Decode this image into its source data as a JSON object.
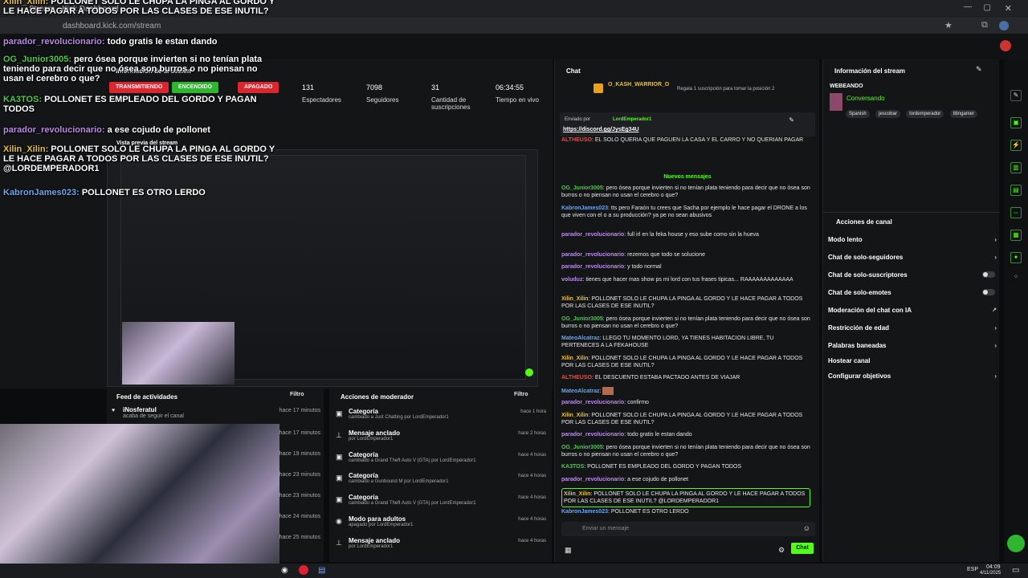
{
  "browser": {
    "tab_title": "Stream - Kick Dashboard",
    "url": "dashboard.kick.com/stream"
  },
  "session": {
    "title": "Información de la sesión",
    "badges": [
      "TRANSMITIENDO",
      "ENCENDIDO",
      "APAGADO"
    ],
    "stats": [
      {
        "value": "131",
        "label": "Espectadores"
      },
      {
        "value": "7098",
        "label": "Seguidores"
      },
      {
        "value": "31",
        "label": "Cantidad de suscripciones"
      },
      {
        "value": "06:34:55",
        "label": "Tiempo en vivo"
      }
    ],
    "preview_title": "Vista previa del stream"
  },
  "feed": {
    "title": "Feed de actividades",
    "filter": "Filtro",
    "items": [
      {
        "name": "iNosferatuI",
        "sub": "acaba de seguir el canal",
        "time": "hace 17 minutos"
      },
      {
        "name": "",
        "sub": "",
        "time": "hace 17 minutos"
      },
      {
        "name": "",
        "sub": "",
        "time": "hace 19 minutos"
      },
      {
        "name": "",
        "sub": "",
        "time": "hace 23 minutos"
      },
      {
        "name": "",
        "sub": "",
        "time": "hace 23 minutos"
      },
      {
        "name": "",
        "sub": "",
        "time": "hace 24 minutos"
      },
      {
        "name": "",
        "sub": "",
        "time": "hace 25 minutos"
      }
    ]
  },
  "mod": {
    "title": "Acciones de moderador",
    "filter": "Filtro",
    "items": [
      {
        "title": "Categoría",
        "sub": "cambiado a Just Chatting por LordEmperador1",
        "time": "hace 1 hora"
      },
      {
        "title": "Mensaje anclado",
        "sub": "por LordEmperador1",
        "time": "hace 2 horas"
      },
      {
        "title": "Categoría",
        "sub": "cambiado a Grand Theft Auto V (GTA) por LordEmperador1",
        "time": "hace 4 horas"
      },
      {
        "title": "Categoría",
        "sub": "cambiado a Gunbound M por LordEmperador1",
        "time": "hace 4 horas"
      },
      {
        "title": "Categoría",
        "sub": "cambiado a Grand Theft Auto V (GTA) por LordEmperador1",
        "time": "hace 4 horas"
      },
      {
        "title": "Modo para adultos",
        "sub": "apagado por LordEmperador1",
        "time": "hace 4 horas"
      },
      {
        "title": "Mensaje anclado",
        "sub": "por LordEmperador1",
        "time": "hace 4 horas"
      }
    ]
  },
  "chat": {
    "title": "Chat",
    "top_user": "O_KASH_WARRIOR_O",
    "gift_text": "Regala 1 suscripción para tomar la posición 2",
    "pinned_by": "Enviado por",
    "pinned_user": "LordEmperador1",
    "pinned_link": "https://discord.gg/JysEg34U",
    "new_messages": "Nuevos mensajes",
    "input_placeholder": "Enviar un mensaje",
    "send_label": "Chat",
    "messages": [
      {
        "user": "ALTHEUSO",
        "text": "EL SOLO QUERIA QUE PAGUEN LA CASA Y EL CARRO Y NO QUERIAN PAGAR",
        "color": "#e0524a"
      },
      {
        "user": "OG_Junior3005",
        "text": "pero ósea porque invierten si no tenían plata teniendo para decir que no ósea son burros o no piensan no usan el cerebro o que?",
        "color": "#4ec94e"
      },
      {
        "user": "KabronJames023",
        "text": "tts pero Faraón tu crees que Sacha por ejemplo le hace pagar el DRONE a los que viven con el o a su producción? ya pe no sean abusivos",
        "color": "#6aa6ee"
      },
      {
        "user": "parador_revolucionario",
        "text": "full irl en la feka house y eso sube como sin la hueva",
        "color": "#b98be8"
      },
      {
        "user": "parador_revolucionario",
        "text": "rezemos que todo se solucione",
        "color": "#b98be8"
      },
      {
        "user": "parador_revolucionario",
        "text": "y todo normal",
        "color": "#b98be8"
      },
      {
        "user": "voluduz",
        "text": "tienes que hacer mas show ps mi lord con tus frases tipicas... RAAAAAAAAAAAAA",
        "color": "#b98be8"
      },
      {
        "user": "Xilin_Xilin",
        "text": "POLLONET SOLO LE CHUPA LA PINGA AL GORDO Y LE HACE PAGAR A TODOS POR LAS CLASES DE ESE INUTIL?",
        "color": "#e8c13a"
      },
      {
        "user": "OG_Junior3005",
        "text": "pero ósea porque invierten si no tenían plata teniendo para decir que no ósea son burros o no piensan no usan el cerebro o que?",
        "color": "#4ec94e"
      },
      {
        "user": "MateoAlcatraz",
        "text": "LLEGO TU MOMENTO LORD, YA TIENES HABITACION LIBRE, TU PERTENECES A LA FEKAHOUSE",
        "color": "#6aa6ee"
      },
      {
        "user": "Xilin_Xilin",
        "text": "POLLONET SOLO LE CHUPA LA PINGA AL GORDO Y LE HACE PAGAR A TODOS POR LAS CLASES DE ESE INUTIL?",
        "color": "#e8c13a"
      },
      {
        "user": "ALTHEUSO",
        "text": "EL DESCUENTO ESTABA PACTADO ANTES DE VIAJAR",
        "color": "#e0524a"
      },
      {
        "user": "MateoAlcatraz",
        "text": "",
        "color": "#6aa6ee"
      },
      {
        "user": "parador_revolucionario",
        "text": "confirmo",
        "color": "#b98be8"
      },
      {
        "user": "Xilin_Xilin",
        "text": "POLLONET SOLO LE CHUPA LA PINGA AL GORDO Y LE HACE PAGAR A TODOS POR LAS CLASES DE ESE INUTIL?",
        "color": "#e8c13a"
      },
      {
        "user": "parador_revolucionario",
        "text": "todo gratis le estan dando",
        "color": "#b98be8"
      },
      {
        "user": "OG_Junior3005",
        "text": "pero ósea porque invierten si no tenían plata teniendo para decir que no ósea son burros o no piensan no usan el cerebro o que?",
        "color": "#4ec94e"
      },
      {
        "user": "KA3TOS",
        "text": "POLLONET ES EMPLEADO DEL GORDO Y PAGAN TODOS",
        "color": "#4ec94e"
      },
      {
        "user": "parador_revolucionario",
        "text": "a ese cojudo de pollonet",
        "color": "#b98be8"
      },
      {
        "user": "Xilin_Xilin",
        "text": "POLLONET SOLO LE CHUPA LA PINGA AL GORDO Y LE HACE PAGAR A TODOS POR LAS CLASES DE ESE INUTIL? @LORDEMPERADOR1",
        "color": "#e8c13a"
      },
      {
        "user": "KabronJames023",
        "text": "POLLONET ES OTRO LERDO",
        "color": "#6aa6ee"
      }
    ]
  },
  "stream_info": {
    "title": "Información del stream",
    "status": "WEBEANDO",
    "category": "Conversando",
    "tags": [
      "Spanish",
      "jescobar",
      "lordemperador",
      "titingamer"
    ]
  },
  "channel_actions": {
    "title": "Acciones de canal",
    "items": [
      {
        "label": "Modo lento",
        "type": "arrow"
      },
      {
        "label": "Chat de solo-seguidores",
        "type": "arrow"
      },
      {
        "label": "Chat de solo-suscriptores",
        "type": "toggle"
      },
      {
        "label": "Chat de solo-emotes",
        "type": "toggle"
      },
      {
        "label": "Moderación del chat con IA",
        "type": "external"
      },
      {
        "label": "Restricción de edad",
        "type": "arrow"
      },
      {
        "label": "Palabras baneadas",
        "type": "arrow"
      },
      {
        "label": "Hostear canal",
        "type": "none"
      },
      {
        "label": "Configurar objetivos",
        "type": "arrow"
      }
    ]
  },
  "overlay": [
    {
      "user": "Xilin_Xilin:",
      "text": "POLLONET SOLO LE CHUPA LA PINGA AL GORDO Y LE HACE PAGAR A TODOS POR LAS CLASES DE ESE INUTIL?",
      "cls": "ov-yellow"
    },
    {
      "user": "parador_revolucionario:",
      "text": "todo gratis le estan dando",
      "cls": "ov-purple"
    },
    {
      "user": "OG_Junior3005:",
      "text": "pero ósea porque invierten si no tenían plata teniendo para decir que no ósea son burros o no piensan no usan el cerebro o que?",
      "cls": "ov-green"
    },
    {
      "user": "KA3TOS:",
      "text": "POLLONET ES EMPLEADO DEL GORDO Y PAGAN TODOS",
      "cls": "ov-green"
    },
    {
      "user": "parador_revolucionario:",
      "text": "a ese cojudo de pollonet",
      "cls": "ov-purple"
    },
    {
      "user": "Xilin_Xilin:",
      "text": "POLLONET SOLO LE CHUPA LA PINGA AL GORDO Y LE HACE PAGAR A TODOS POR LAS CLASES DE ESE INUTIL? @LORDEMPERADOR1",
      "cls": "ov-yellow"
    },
    {
      "user": "KabronJames023:",
      "text": "POLLONET ES OTRO LERDO",
      "cls": "ov-blue"
    }
  ],
  "taskbar": {
    "lang": "ESP",
    "time": "04:09",
    "date": "4/11/2025"
  }
}
